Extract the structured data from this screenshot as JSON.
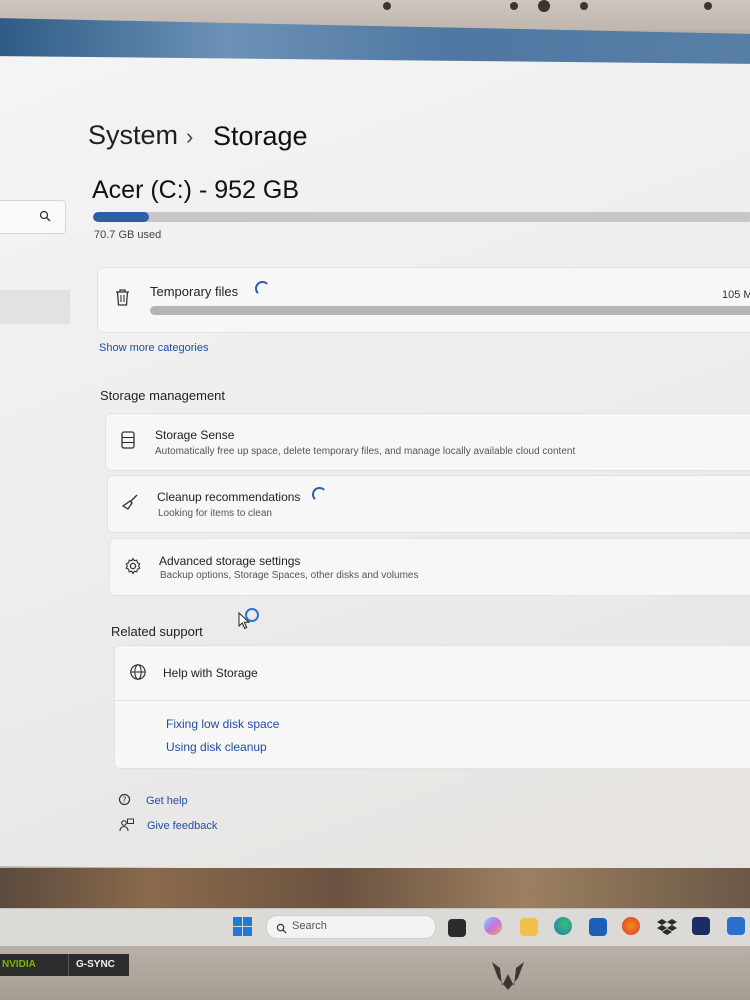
{
  "breadcrumb": {
    "parent": "System",
    "separator": "›",
    "current": "Storage"
  },
  "drive": {
    "title": "Acer (C:) - 952 GB",
    "used_text": "70.7 GB used",
    "used_fraction": 0.085
  },
  "temp_files": {
    "label": "Temporary files",
    "size": "105 M"
  },
  "show_more": "Show more categories",
  "storage_management": {
    "title": "Storage management",
    "items": [
      {
        "title": "Storage Sense",
        "subtitle": "Automatically free up space, delete temporary files, and manage locally available cloud content"
      },
      {
        "title": "Cleanup recommendations",
        "subtitle": "Looking for items to clean"
      },
      {
        "title": "Advanced storage settings",
        "subtitle": "Backup options, Storage Spaces, other disks and volumes"
      }
    ]
  },
  "related_support": {
    "title": "Related support",
    "help": "Help with Storage",
    "links": [
      "Fixing low disk space",
      "Using disk cleanup"
    ]
  },
  "footer": {
    "get_help": "Get help",
    "give_feedback": "Give feedback"
  },
  "taskbar": {
    "search_placeholder": "Search"
  },
  "bezel": {
    "nvidia": "NVIDIA",
    "gsync": "G-SYNC"
  },
  "colors": {
    "accent": "#2f5ea8",
    "link": "#1f4ea3"
  }
}
